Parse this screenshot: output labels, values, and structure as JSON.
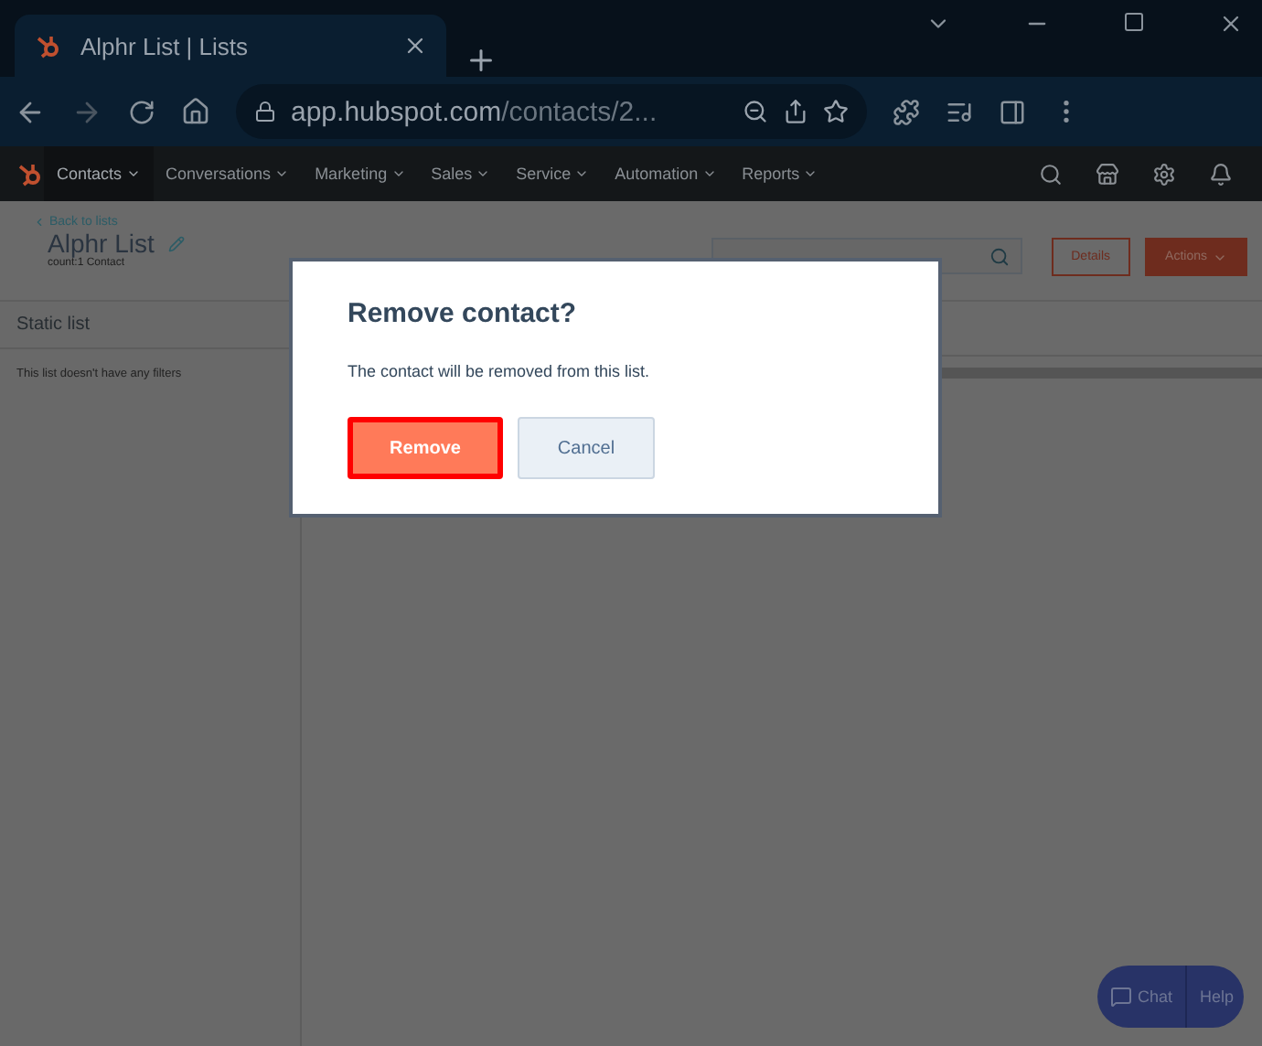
{
  "browser": {
    "tab_title": "Alphr List | Lists",
    "url_host": "app.hubspot.com",
    "url_path": "/contacts/2..."
  },
  "nav": [
    {
      "label": "Contacts",
      "selected": true
    },
    {
      "label": "Conversations",
      "selected": false
    },
    {
      "label": "Marketing",
      "selected": false
    },
    {
      "label": "Sales",
      "selected": false
    },
    {
      "label": "Service",
      "selected": false
    },
    {
      "label": "Automation",
      "selected": false
    },
    {
      "label": "Reports",
      "selected": false
    }
  ],
  "header": {
    "back_link": "Back to lists",
    "title": "Alphr List",
    "count": "count:1 Contact",
    "buttons": [
      {
        "label": "Details",
        "kind": "outline"
      },
      {
        "label": "Actions",
        "kind": "solid"
      }
    ]
  },
  "sidebar": {
    "heading": "Static list",
    "message": "This list doesn't have any filters"
  },
  "modal": {
    "title": "Remove contact?",
    "message": "The contact will be removed from this list.",
    "buttons": [
      {
        "label": "Remove",
        "kind": "primary",
        "focused": true
      },
      {
        "label": "Cancel",
        "kind": "secondary",
        "focused": false
      }
    ]
  },
  "chat": {
    "chat": "Chat",
    "help": "Help"
  }
}
